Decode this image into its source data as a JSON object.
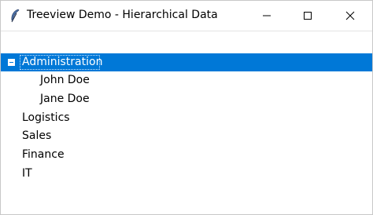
{
  "window": {
    "title": "Treeview Demo - Hierarchical Data",
    "icon": "feather-icon",
    "controls": {
      "minimize": "minimize-icon",
      "maximize": "maximize-icon",
      "close": "close-icon"
    }
  },
  "tree": {
    "selected_color": "#0078d7",
    "items": [
      {
        "label": "Administration",
        "expanded": true,
        "selected": true
      },
      {
        "label": "John Doe",
        "child": true
      },
      {
        "label": "Jane Doe",
        "child": true
      },
      {
        "label": "Logistics"
      },
      {
        "label": "Sales"
      },
      {
        "label": "Finance"
      },
      {
        "label": "IT"
      }
    ]
  }
}
